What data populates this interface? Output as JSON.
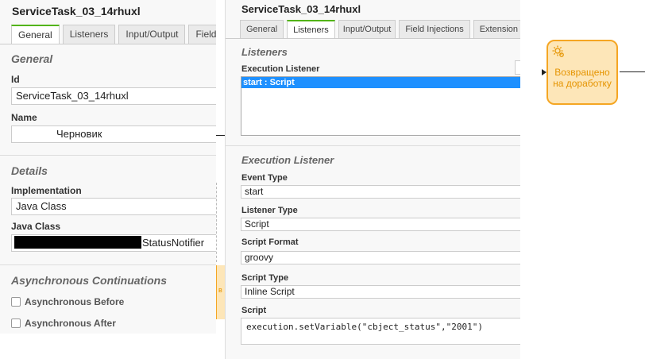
{
  "left": {
    "title": "ServiceTask_03_14rhuxl",
    "tabs": [
      "General",
      "Listeners",
      "Input/Output",
      "Field I"
    ],
    "general_header": "General",
    "id_label": "Id",
    "id_value": "ServiceTask_03_14rhuxl",
    "name_label": "Name",
    "name_value": "Черновик",
    "details_header": "Details",
    "implementation_label": "Implementation",
    "implementation_value": "Java Class",
    "java_class_label": "Java Class",
    "java_class_value": "StatusNotifier",
    "async_header": "Asynchronous Continuations",
    "async_before": "Asynchronous Before",
    "async_after": "Asynchronous After"
  },
  "middle": {
    "title": "ServiceTask_03_14rhuxl",
    "tabs": [
      "General",
      "Listeners",
      "Input/Output",
      "Field Injections",
      "Extension"
    ],
    "listeners_header": "Listeners",
    "execution_listener_label": "Execution Listener",
    "listener_items": [
      "start : Script"
    ],
    "execution_listener_header": "Execution Listener",
    "event_type_label": "Event Type",
    "event_type_value": "start",
    "listener_type_label": "Listener Type",
    "listener_type_value": "Script",
    "script_format_label": "Script Format",
    "script_format_value": "groovy",
    "script_type_label": "Script Type",
    "script_type_value": "Inline Script",
    "script_label": "Script",
    "script_value": "execution.setVariable(\"cbject_status\",\"2001\")"
  },
  "canvas": {
    "task_label": "Возвращено на доработку",
    "strip_char": "в"
  },
  "icons": {
    "task_type": "gear-icon"
  },
  "colors": {
    "active_tab_accent": "#52b415",
    "selection": "#1e90ff",
    "task_fill": "#fde6b8",
    "task_border": "#f5a623"
  }
}
